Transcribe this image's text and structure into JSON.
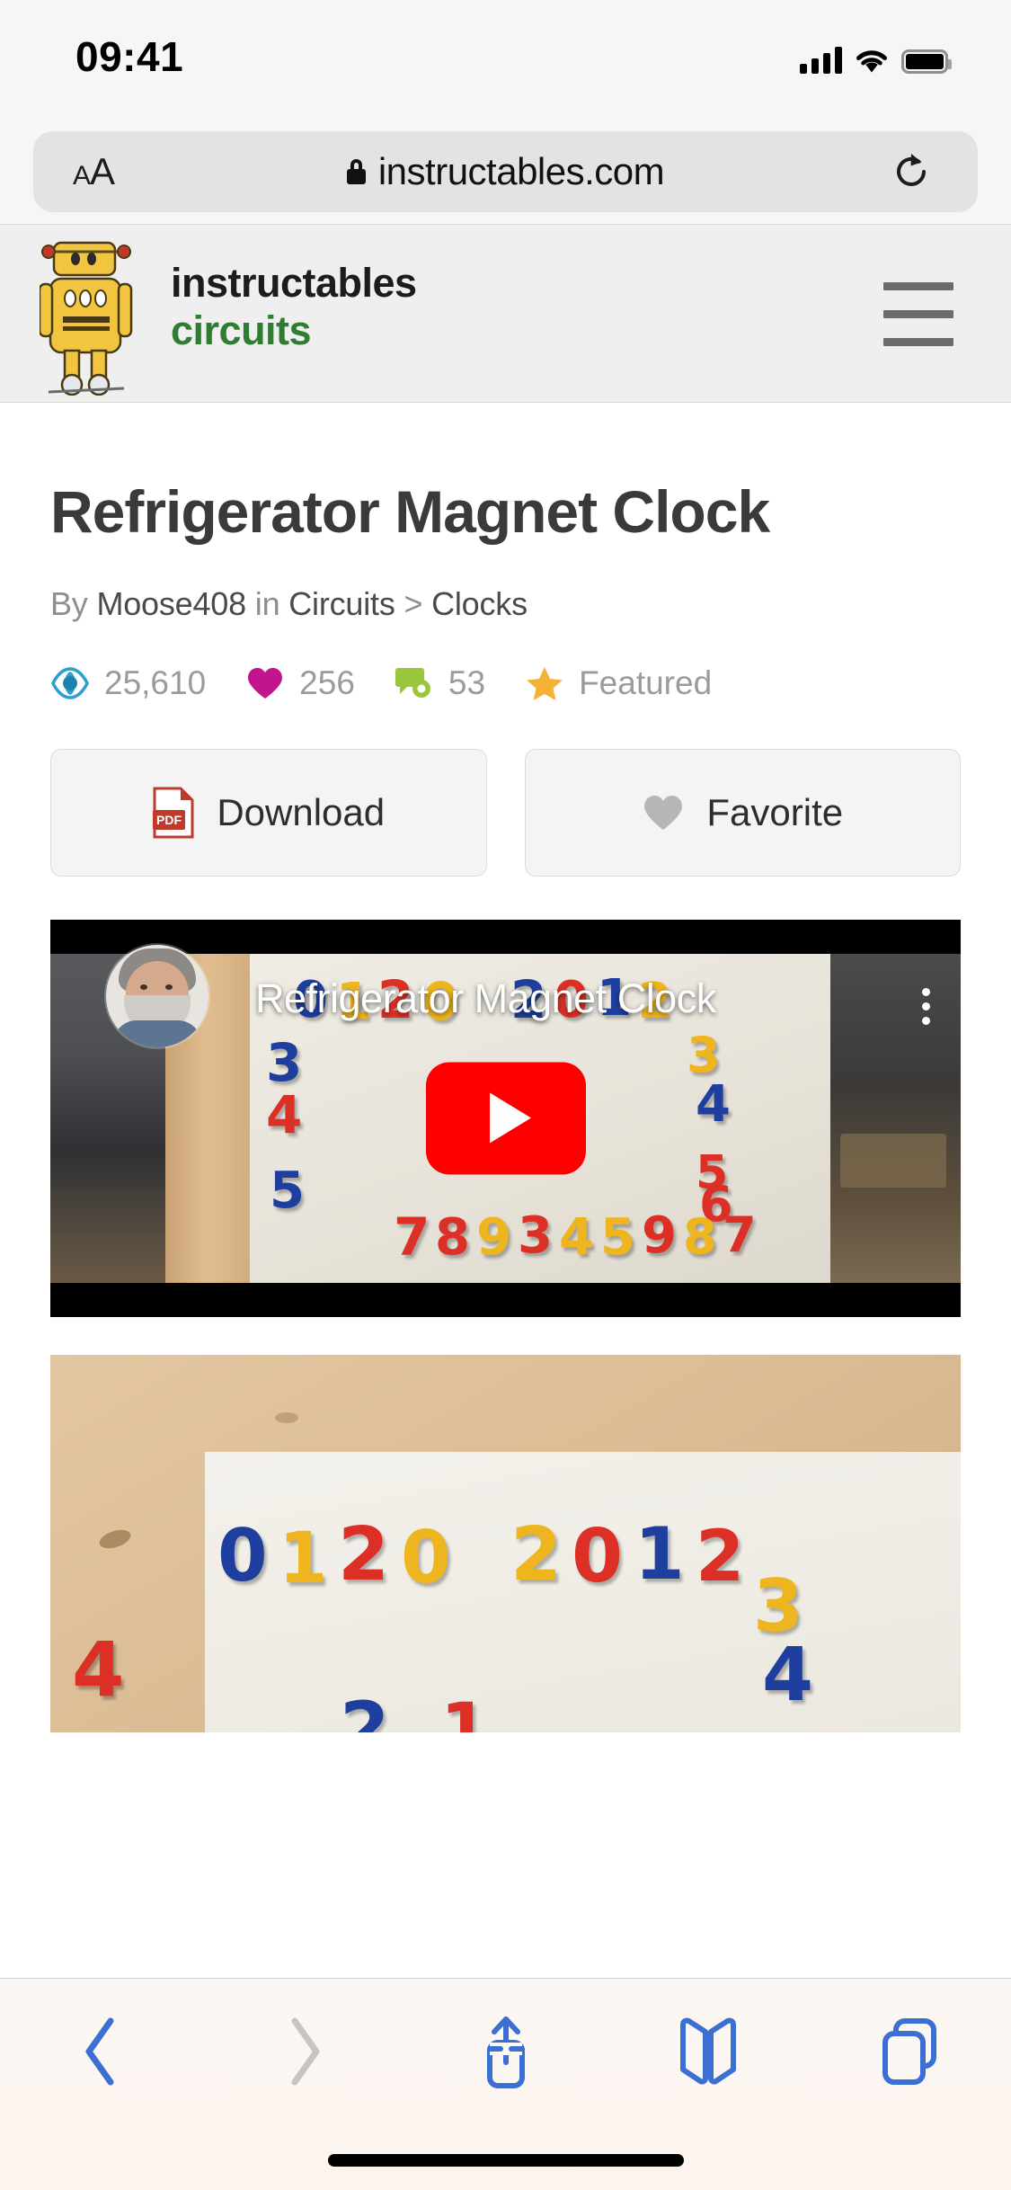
{
  "status_bar": {
    "time": "09:41",
    "icons": [
      "cellular-signal-icon",
      "wifi-icon",
      "battery-icon"
    ]
  },
  "browser": {
    "text_size_label": "AA",
    "url": "instructables.com",
    "secure_icon": "lock-icon",
    "reload_icon": "reload-icon",
    "toolbar": {
      "back_label": "Back",
      "forward_label": "Forward",
      "share_label": "Share",
      "bookmarks_label": "Bookmarks",
      "tabs_label": "Tabs"
    }
  },
  "site_header": {
    "brand_line1": "instructables",
    "brand_line2": "circuits",
    "brand_color": "#2e7d32",
    "logo_icon": "instructables-robot-logo",
    "menu_icon": "hamburger-menu-icon"
  },
  "article": {
    "title": "Refrigerator Magnet Clock",
    "byline": {
      "by_label": "By",
      "author": "Moose408",
      "in_label": "in",
      "category": "Circuits",
      "separator": ">",
      "subcategory": "Clocks"
    },
    "stats": [
      {
        "icon": "views-eye-icon",
        "value": "25,610",
        "color": "#2a9fd0"
      },
      {
        "icon": "favorites-heart-icon",
        "value": "256",
        "color": "#c2148c"
      },
      {
        "icon": "comments-bubble-icon",
        "value": "53",
        "color": "#9ac63b"
      },
      {
        "icon": "featured-star-icon",
        "value": "Featured",
        "color": "#f5b335"
      }
    ],
    "actions": [
      {
        "icon": "pdf-download-icon",
        "label": "Download"
      },
      {
        "icon": "heart-outline-icon",
        "label": "Favorite"
      }
    ],
    "video": {
      "platform": "YouTube",
      "title": "Refrigerator Magnet Clock",
      "play_icon": "youtube-play-button",
      "more_icon": "more-options-icon",
      "avatar_icon": "channel-avatar",
      "magnet_top_row": [
        "0",
        "1",
        "2",
        "0",
        "2",
        "0",
        "1",
        "2"
      ],
      "magnet_left_col": [
        "3",
        "4",
        "5"
      ],
      "magnet_right_col": [
        "3",
        "4",
        "5",
        "6"
      ],
      "magnet_bottom_row": [
        "7",
        "8",
        "9",
        "3",
        "4",
        "5",
        "9",
        "8",
        "7"
      ]
    },
    "photo": {
      "alt": "Whiteboard with colored magnetic numbers on wood background",
      "magnets": [
        "0",
        "1",
        "2",
        "0",
        "2",
        "0",
        "1",
        "2",
        "3",
        "4",
        "4"
      ]
    }
  }
}
